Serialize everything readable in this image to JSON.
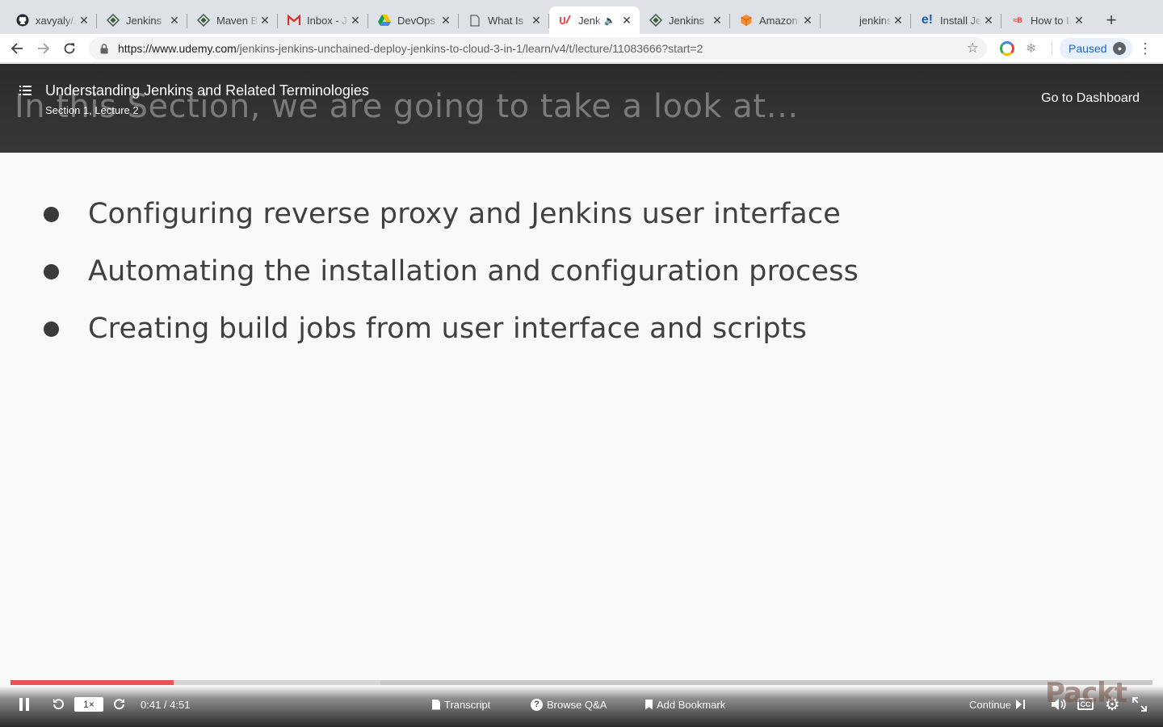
{
  "browser": {
    "tabs": [
      {
        "title": "xavyaly/...",
        "icon": "github-icon",
        "active": false
      },
      {
        "title": "Jenkins",
        "icon": "jenkins-diamond-icon",
        "active": false
      },
      {
        "title": "Maven B...",
        "icon": "jenkins-diamond-icon",
        "active": false
      },
      {
        "title": "Inbox - J...",
        "icon": "gmail-icon",
        "active": false
      },
      {
        "title": "DevOps",
        "icon": "google-drive-icon",
        "active": false
      },
      {
        "title": "What Is",
        "icon": "document-icon",
        "active": false
      },
      {
        "title": "Jenk",
        "icon": "udemy-icon",
        "active": true,
        "audio": true
      },
      {
        "title": "Jenkins",
        "icon": "jenkins-diamond-icon",
        "active": false
      },
      {
        "title": "Amazon",
        "icon": "aws-cube-icon",
        "active": false
      },
      {
        "title": "jenkins-...",
        "icon": "blank-icon",
        "active": false
      },
      {
        "title": "Install Je...",
        "icon": "e-icon",
        "active": false
      },
      {
        "title": "How to I...",
        "icon": "brand-icon",
        "active": false
      }
    ],
    "url_host": "https://www.udemy.com",
    "url_path": "/jenkins-jenkins-unchained-deploy-jenkins-to-cloud-3-in-1/learn/v4/t/lecture/11083666?start=2",
    "profile_label": "Paused"
  },
  "lecture": {
    "title": "Understanding Jenkins and Related Terminologies",
    "subtitle": "Section 1, Lecture 2",
    "dashboard_label": "Go to Dashboard",
    "slide_heading": "In this Section, we are going to take a look at…",
    "bullets": [
      "Configuring reverse proxy and Jenkins user interface",
      "Automating the installation and configuration process",
      "Creating build jobs from user interface and scripts"
    ]
  },
  "player": {
    "played_fraction": 0.143,
    "buffered_fraction": 0.324,
    "speed_label": "1×",
    "time_label": "0:41 / 4:51",
    "transcript_label": "Transcript",
    "qa_label": "Browse Q&A",
    "bookmark_label": "Add Bookmark",
    "continue_label": "Continue",
    "watermark": "Packt",
    "accent_color": "#ec5252"
  }
}
